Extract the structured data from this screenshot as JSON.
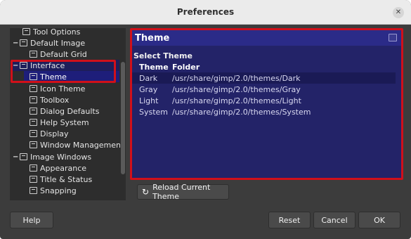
{
  "window": {
    "title": "Preferences",
    "close_glyph": "✕"
  },
  "sidebar": {
    "items": [
      {
        "label": "Tool Options",
        "icon": "tool-options-icon",
        "level": 1
      },
      {
        "label": "Default Image",
        "icon": "image-icon",
        "level": 0,
        "expander": "−"
      },
      {
        "label": "Default Grid",
        "icon": "grid-icon",
        "level": 1
      },
      {
        "label": "Interface",
        "icon": "interface-icon",
        "level": 0,
        "expander": "−"
      },
      {
        "label": "Theme",
        "icon": "theme-icon",
        "level": 1
      },
      {
        "label": "Icon Theme",
        "icon": "icon-theme-icon",
        "level": 1
      },
      {
        "label": "Toolbox",
        "icon": "toolbox-icon",
        "level": 1
      },
      {
        "label": "Dialog Defaults",
        "icon": "dialog-defaults-icon",
        "level": 1
      },
      {
        "label": "Help System",
        "icon": "help-system-icon",
        "level": 1
      },
      {
        "label": "Display",
        "icon": "display-icon",
        "level": 1
      },
      {
        "label": "Window Management",
        "icon": "window-management-icon",
        "level": 1
      },
      {
        "label": "Image Windows",
        "icon": "image-windows-icon",
        "level": 0,
        "expander": "−"
      },
      {
        "label": "Appearance",
        "icon": "appearance-icon",
        "level": 1
      },
      {
        "label": "Title & Status",
        "icon": "title-status-icon",
        "level": 1
      },
      {
        "label": "Snapping",
        "icon": "snapping-icon",
        "level": 1
      }
    ]
  },
  "panel": {
    "title": "Theme",
    "section_label": "Select Theme",
    "columns": [
      "Theme",
      "Folder"
    ],
    "rows": [
      {
        "theme": "Dark",
        "folder": "/usr/share/gimp/2.0/themes/Dark"
      },
      {
        "theme": "Gray",
        "folder": "/usr/share/gimp/2.0/themes/Gray"
      },
      {
        "theme": "Light",
        "folder": "/usr/share/gimp/2.0/themes/Light"
      },
      {
        "theme": "System",
        "folder": "/usr/share/gimp/2.0/themes/System"
      }
    ],
    "reload_label": "Reload Current Theme"
  },
  "footer": {
    "help": "Help",
    "reset": "Reset",
    "cancel": "Cancel",
    "ok": "OK"
  },
  "colors": {
    "highlight": "#d0101a",
    "panel_bg": "#232368",
    "selected": "#1e1e7a"
  }
}
